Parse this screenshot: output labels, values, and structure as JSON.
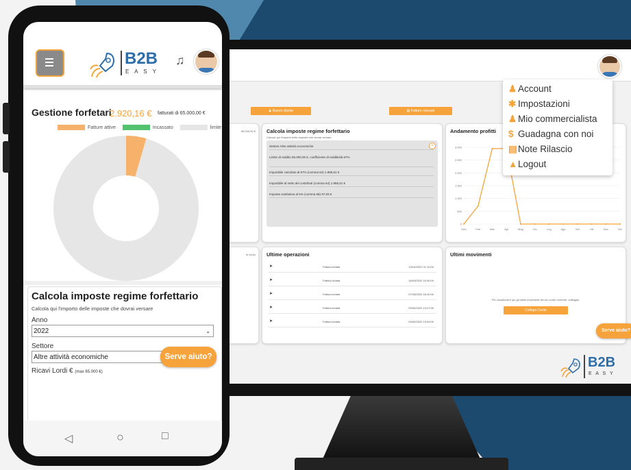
{
  "colors": {
    "orange": "#f6a33b",
    "navy": "#1c4a6e",
    "light_blue": "#4f87ad"
  },
  "desktop": {
    "buttons": {
      "new_client": "Nuovo cliente",
      "received_invoices": "Fatture ricevute"
    },
    "calc_card": {
      "title": "Calcola imposte regime forfettario",
      "subtitle": "Calcola qui l'importo delle imposte che dovrai versare",
      "sector": "Settore Altre attività economiche",
      "rows": [
        "Limite di reddito 65.000,00 €, coefficiente di redditività 67%",
        "Imponibile calcolato al 67% (comma 64) 1.955,51 €",
        "Imponibile al netto dei contributi (comma 64) 1.955,51 €",
        "Imposta sostitutiva al 5% (comma 65) 97,83 €"
      ]
    },
    "left_stub_text": "65.000,00 €",
    "left_stub_text2": "in corso",
    "profit_chart": {
      "title": "Andamento profitti",
      "chart_data": {
        "type": "line",
        "title": "Andamento profitti",
        "categories": [
          "Gen",
          "Feb",
          "Mar",
          "Apr",
          "Mag",
          "Giu",
          "Lug",
          "Ago",
          "Set",
          "Ott",
          "Nov",
          "Dic"
        ],
        "series": [
          {
            "values": [
              0,
              700,
              2950,
              2950,
              0,
              0,
              0,
              0,
              0,
              0,
              0,
              0
            ]
          }
        ],
        "yticks": [
          "0",
          "500",
          "1.000",
          "1.500",
          "2.000",
          "2.500",
          "3.000"
        ],
        "ylim": [
          0,
          3000
        ],
        "color": "#f6a33b"
      }
    },
    "ops": {
      "title": "Ultime operazioni",
      "rows": [
        {
          "label": "Fattura inviata",
          "date": "12/04/2022 11:10:00"
        },
        {
          "label": "Fattura inviata",
          "date": "16/03/2022 16:30:00"
        },
        {
          "label": "Fattura inviata",
          "date": "07/03/2022 18:40:00"
        },
        {
          "label": "Fattura inviata",
          "date": "09/02/2022 13:27:00"
        },
        {
          "label": "Fattura inviata",
          "date": "09/02/2022 13:09:00"
        }
      ]
    },
    "movements": {
      "title": "Ultimi movimenti",
      "text": "Per visualizzare qui gli ultimi movimenti del tuo conto corrente, collegalo.",
      "button": "Collega Conto"
    },
    "help": "Serve aiuto?",
    "logo": {
      "main": "B2B",
      "sub": "E A S Y"
    },
    "menu": [
      {
        "icon": "user-icon",
        "glyph": "♟",
        "label": "Account"
      },
      {
        "icon": "gear-icon",
        "glyph": "✱",
        "label": "Impostazioni"
      },
      {
        "icon": "user-icon",
        "glyph": "♟",
        "label": "Mio commercialista"
      },
      {
        "icon": "dollar-icon",
        "glyph": "$",
        "label": "Guadagna con noi"
      },
      {
        "icon": "document-icon",
        "glyph": "▤",
        "label": "Note Rilascio"
      },
      {
        "icon": "lock-icon",
        "glyph": "▲",
        "label": "Logout"
      }
    ]
  },
  "phone": {
    "logo": {
      "main": "B2B",
      "sub": "E A S Y"
    },
    "gestione": {
      "title": "Gestione forfetari",
      "amount": "2.920,16 €",
      "of_text": "fatturati di 65.000,00 €",
      "legend": [
        "Fatture attive",
        "Incassato",
        "limite"
      ],
      "chart_data": {
        "type": "pie",
        "slices": [
          {
            "name": "Fatture attive",
            "value": 2920.16
          },
          {
            "name": "limite",
            "value": 62079.84
          }
        ],
        "colors": [
          "#f6b26b",
          "#e6e6e6"
        ]
      }
    },
    "calc": {
      "title": "Calcola imposte regime forfettario",
      "subtitle": "Calcola qui l'importo delle imposte che dovrai versare",
      "anno_label": "Anno",
      "anno_value": "2022",
      "settore_label": "Settore",
      "settore_value": "Altre attività economiche",
      "ricavi_label": "Ricavi Lordi €",
      "ricavi_hint": "(max 65.000 €)"
    },
    "help": "Serve aiuto?",
    "nav": {
      "back": "◁",
      "home": "○",
      "recent": "□"
    }
  }
}
